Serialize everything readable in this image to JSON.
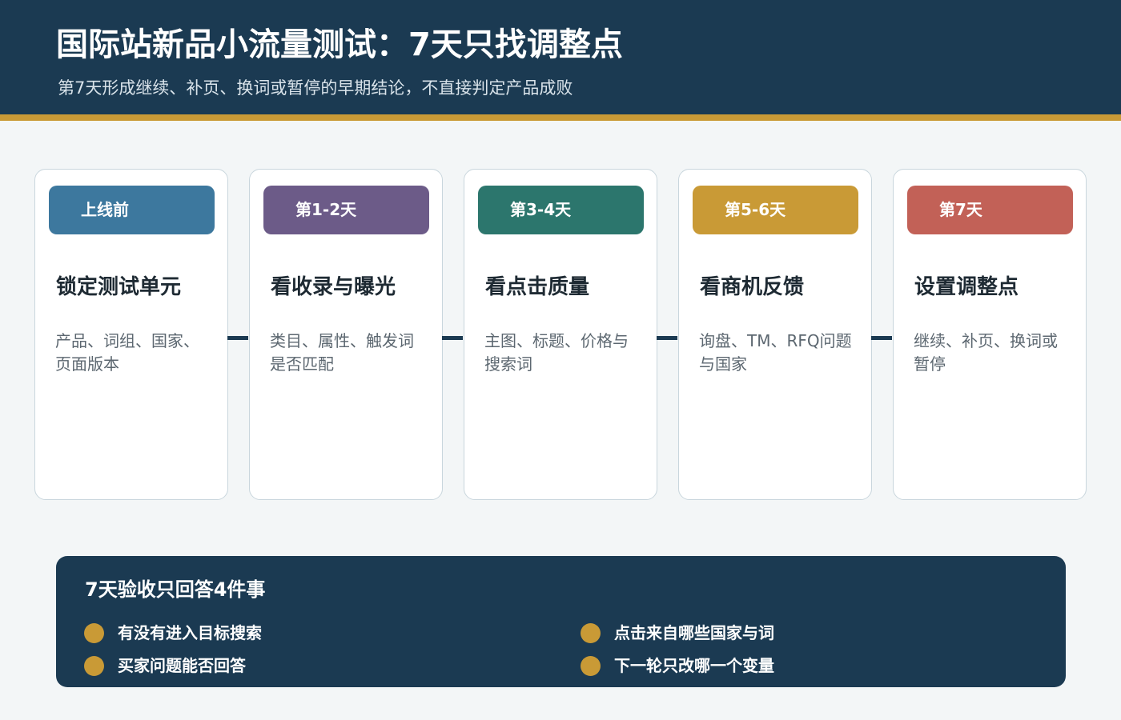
{
  "header": {
    "title": "国际站新品小流量测试：7天只找调整点",
    "subtitle": "第7天形成继续、补页、换词或暂停的早期结论，不直接判定产品成败"
  },
  "steps": [
    {
      "stage": "上线前",
      "heading": "锁定测试单元",
      "description": "产品、词组、国家、页面版本",
      "color": "#3d789e"
    },
    {
      "stage": "第1-2天",
      "heading": "看收录与曝光",
      "description": "类目、属性、触发词是否匹配",
      "color": "#6c5b88"
    },
    {
      "stage": "第3-4天",
      "heading": "看点击质量",
      "description": "主图、标题、价格与搜索词",
      "color": "#2c766d"
    },
    {
      "stage": "第5-6天",
      "heading": "看商机反馈",
      "description": "询盘、TM、RFQ问题与国家",
      "color": "#c99a36"
    },
    {
      "stage": "第7天",
      "heading": "设置调整点",
      "description": "继续、补页、换词或暂停",
      "color": "#c26157"
    }
  ],
  "summary": {
    "title": "7天验收只回答4件事",
    "items": [
      "有没有进入目标搜索",
      "点击来自哪些国家与词",
      "买家问题能否回答",
      "下一轮只改哪一个变量"
    ]
  }
}
